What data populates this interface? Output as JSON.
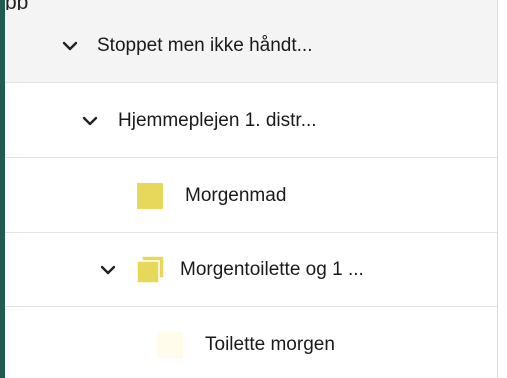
{
  "top_fragment": "pp",
  "colors": {
    "accent_bar": "#1f5c4f",
    "task_yellow": "#e6d85a",
    "task_pale": "#fffcec",
    "row_shaded": "#f4f4f4"
  },
  "tree": {
    "rows": [
      {
        "label": "Stoppet men ikke håndt...",
        "icon": "chevron-down-icon",
        "expanded": true
      },
      {
        "label": "Hjemmeplejen 1. distr...",
        "icon": "chevron-down-icon",
        "expanded": true
      },
      {
        "label": "Morgenmad",
        "icon": "task-square-icon"
      },
      {
        "label": "Morgentoilette og 1 ...",
        "icon": "stacked-tasks-icon",
        "expanded": true
      },
      {
        "label": "Toilette morgen",
        "icon": "pale-task-square-icon"
      }
    ]
  }
}
